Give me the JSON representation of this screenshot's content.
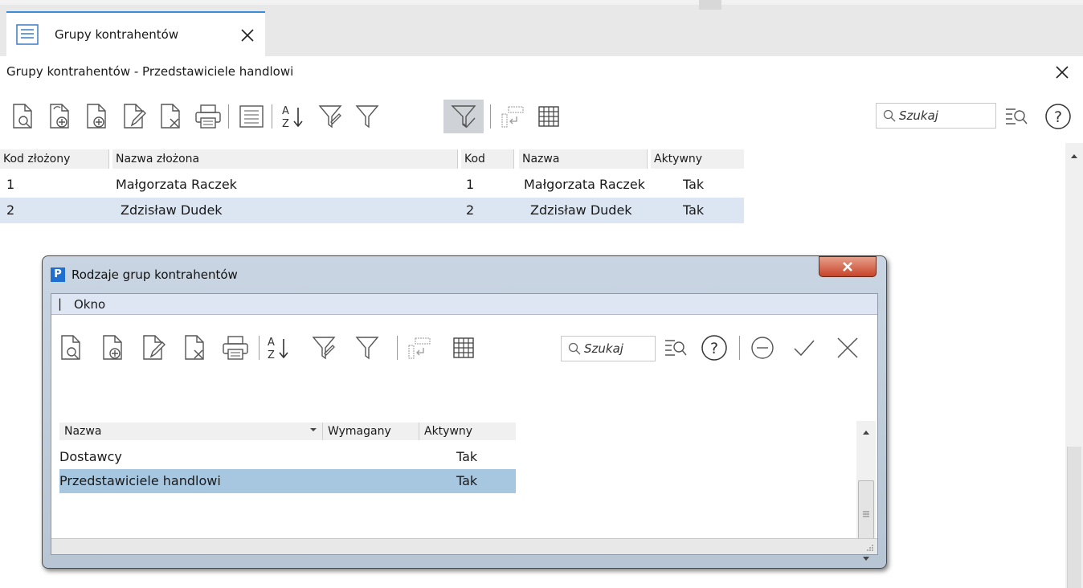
{
  "tab": {
    "label": "Grupy kontrahentów"
  },
  "page": {
    "title": "Grupy kontrahentów - Przedstawiciele handlowi"
  },
  "toolbar": {
    "search_placeholder": "Szukaj"
  },
  "main_grid": {
    "columns": [
      "Kod złożony",
      "Nazwa złożona",
      "Kod",
      "Nazwa",
      "Aktywny"
    ],
    "rows": [
      {
        "kod_zlozony": "1",
        "nazwa_zlozona": "Małgorzata Raczek",
        "kod": "1",
        "nazwa": "Małgorzata Raczek",
        "aktywny": "Tak",
        "selected": false
      },
      {
        "kod_zlozony": "2",
        "nazwa_zlozona": "Zdzisław Dudek",
        "kod": "2",
        "nazwa": "Zdzisław Dudek",
        "aktywny": "Tak",
        "selected": true
      }
    ]
  },
  "dialog": {
    "title": "Rodzaje grup kontrahentów",
    "app_badge": "P",
    "menu": [
      "Okno"
    ],
    "search_placeholder": "Szukaj",
    "columns": [
      "Nazwa",
      "Wymagany",
      "Aktywny"
    ],
    "rows": [
      {
        "nazwa": "Dostawcy",
        "wymagany": "",
        "aktywny": "Tak",
        "selected": false
      },
      {
        "nazwa": "Przedstawiciele handlowi",
        "wymagany": "",
        "aktywny": "Tak",
        "selected": true
      }
    ]
  },
  "icons": [
    "list-view-icon",
    "close-icon",
    "preview-icon",
    "add-copy-icon",
    "add-icon",
    "edit-icon",
    "delete-icon",
    "print-icon",
    "details-icon",
    "sort-az-icon",
    "filter-clear-icon",
    "filter-icon",
    "filter-active-icon",
    "columns-icon",
    "grid-icon",
    "search-icon",
    "advanced-search-icon",
    "help-icon",
    "minus-circle-icon",
    "checkmark-icon",
    "cancel-icon"
  ],
  "colors": {
    "accent": "#3a8ed6",
    "selected_row": "#dce6f2",
    "dialog_selected_row": "#a7c6e0",
    "close_red": "#c8432a"
  }
}
